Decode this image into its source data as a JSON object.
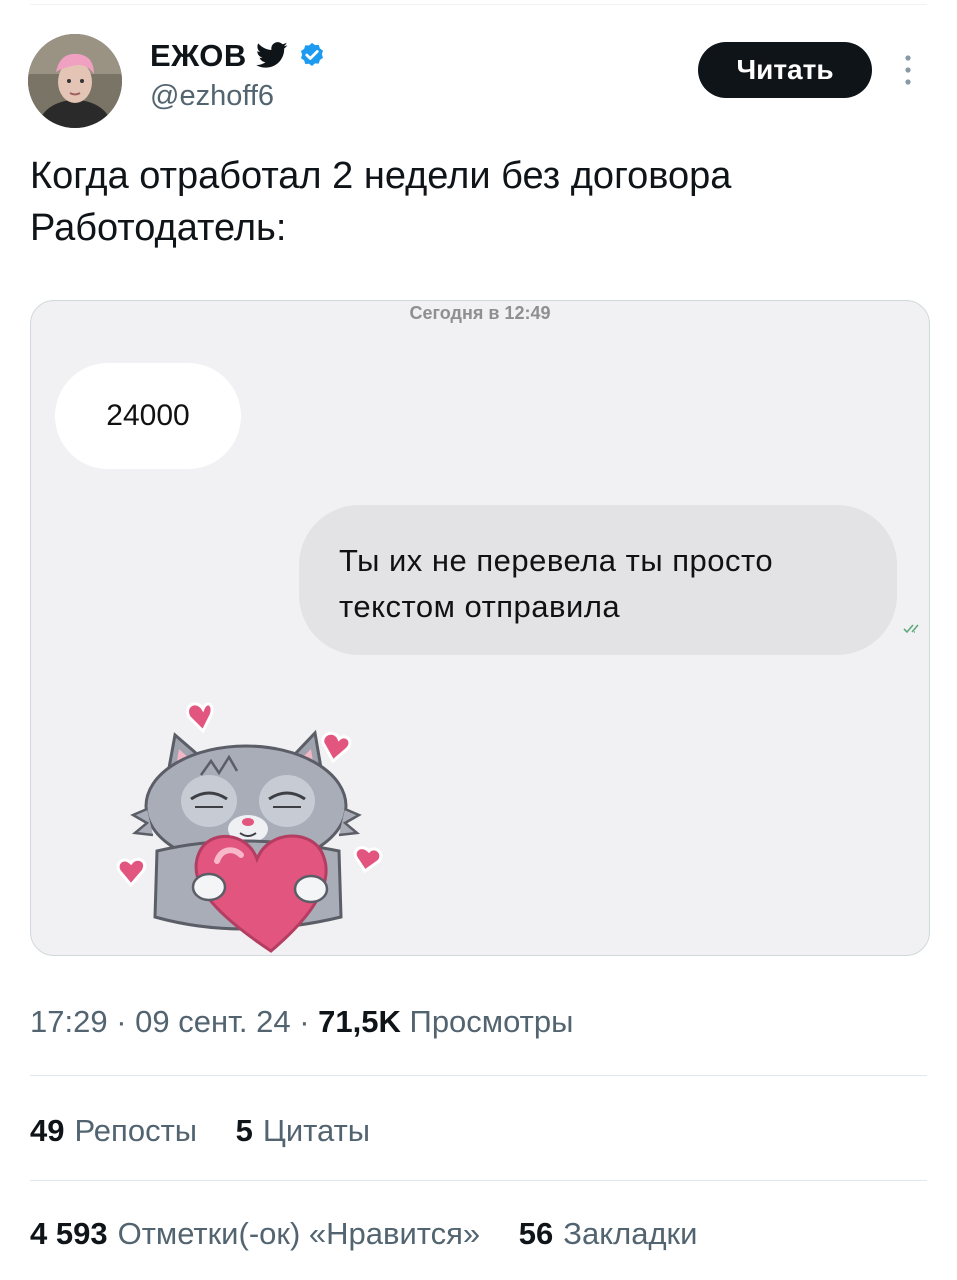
{
  "tweet": {
    "author": {
      "name": "ЕЖОВ",
      "handle": "@ezhoff6",
      "verified": true
    },
    "follow_label": "Читать",
    "text_lines": [
      "Когда отработал 2 недели без договора",
      "Работодатель:"
    ],
    "media": {
      "date_label": "Сегодня в 12:49",
      "incoming_message": "24000",
      "outgoing_lines": [
        "Ты их не перевела ты просто",
        "текстом отправила"
      ],
      "sticker": "cat-hugging-heart"
    },
    "meta": {
      "time": "17:29",
      "date": "09 сент. 24",
      "views_count": "71,5K",
      "views_label": "Просмотры",
      "separator": "·"
    },
    "stats": {
      "reposts": {
        "count": "49",
        "label": "Репосты"
      },
      "quotes": {
        "count": "5",
        "label": "Цитаты"
      },
      "likes": {
        "count": "4 593",
        "label": "Отметки(-ок) «Нравится»"
      },
      "bookmarks": {
        "count": "56",
        "label": "Закладки"
      }
    }
  },
  "icons": {
    "platform": "bird-icon",
    "verified": "verified-badge-icon",
    "more": "more-vertical-icon",
    "read": "double-check-icon"
  },
  "colors": {
    "verified": "#1d9bf0",
    "button": "#0f1419",
    "secondary_text": "#536471",
    "read_ticks": "#5fa97c",
    "heart": "#e2557f"
  }
}
